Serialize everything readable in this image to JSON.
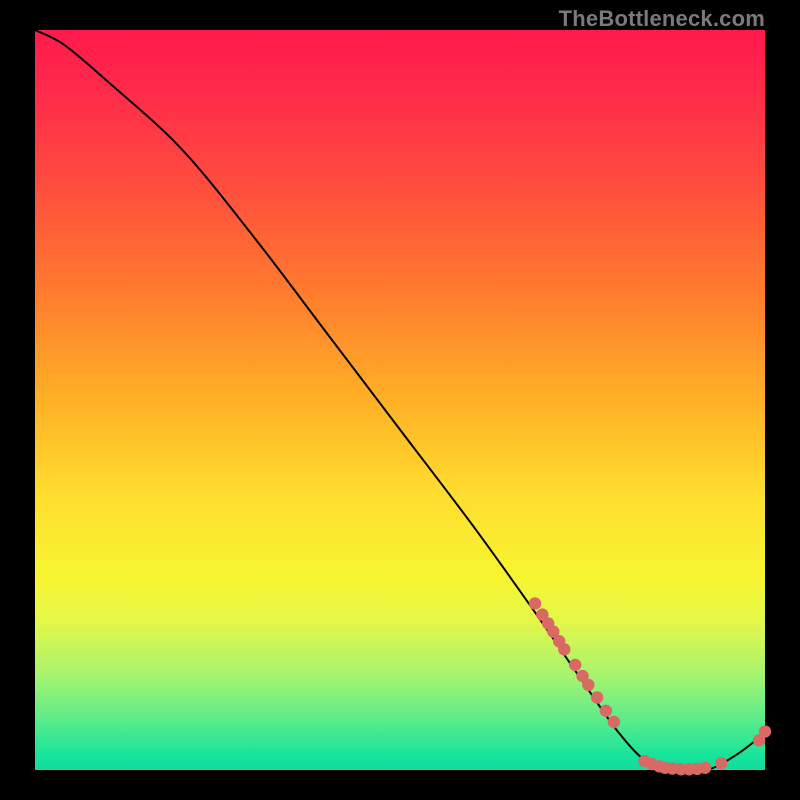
{
  "watermark": "TheBottleneck.com",
  "chart_data": {
    "type": "line",
    "title": "",
    "xlabel": "",
    "ylabel": "",
    "xlim": [
      0,
      100
    ],
    "ylim": [
      0,
      100
    ],
    "series": [
      {
        "name": "bottleneck-curve",
        "x": [
          0,
          4,
          10,
          20,
          30,
          40,
          50,
          60,
          68,
          75,
          80,
          84,
          88,
          92,
          96,
          100
        ],
        "y": [
          100,
          98,
          93,
          84,
          72,
          59,
          46,
          33,
          22,
          12,
          5,
          1,
          0,
          0,
          2,
          5
        ],
        "stroke": "#000000"
      }
    ],
    "markers": [
      {
        "name": "cluster-upper",
        "shape": "circle",
        "color": "#d96a63",
        "points": [
          {
            "x": 68.5,
            "y": 22.5
          },
          {
            "x": 69.5,
            "y": 21.0
          },
          {
            "x": 70.3,
            "y": 19.8
          },
          {
            "x": 71.0,
            "y": 18.7
          },
          {
            "x": 71.8,
            "y": 17.4
          },
          {
            "x": 72.5,
            "y": 16.3
          },
          {
            "x": 74.0,
            "y": 14.2
          },
          {
            "x": 75.0,
            "y": 12.7
          },
          {
            "x": 75.8,
            "y": 11.5
          },
          {
            "x": 77.0,
            "y": 9.8
          },
          {
            "x": 78.2,
            "y": 8.0
          },
          {
            "x": 79.3,
            "y": 6.5
          }
        ]
      },
      {
        "name": "cluster-valley",
        "shape": "circle",
        "color": "#d96a63",
        "points": [
          {
            "x": 83.5,
            "y": 1.2
          },
          {
            "x": 84.5,
            "y": 0.8
          },
          {
            "x": 85.5,
            "y": 0.5
          },
          {
            "x": 86.3,
            "y": 0.3
          },
          {
            "x": 87.3,
            "y": 0.2
          },
          {
            "x": 88.5,
            "y": 0.1
          },
          {
            "x": 89.6,
            "y": 0.1
          },
          {
            "x": 90.7,
            "y": 0.15
          },
          {
            "x": 91.8,
            "y": 0.3
          },
          {
            "x": 94.0,
            "y": 0.9
          }
        ]
      },
      {
        "name": "cluster-tail",
        "shape": "circle",
        "color": "#d96a63",
        "points": [
          {
            "x": 99.2,
            "y": 4.0
          },
          {
            "x": 100.0,
            "y": 5.2
          }
        ]
      }
    ]
  }
}
